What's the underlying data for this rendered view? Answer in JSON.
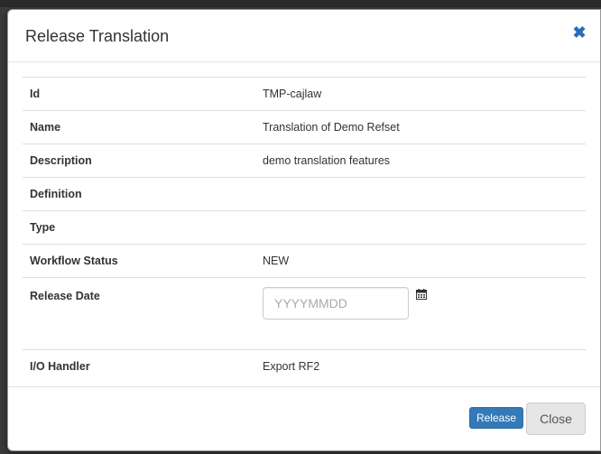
{
  "dialog": {
    "title": "Release Translation",
    "close_icon": "close-x-icon",
    "accent": "#2a6ebb"
  },
  "fields": [
    {
      "label": "Id",
      "value": "TMP-cajlaw"
    },
    {
      "label": "Name",
      "value": "Translation of Demo Refset"
    },
    {
      "label": "Description",
      "value": "demo translation features"
    },
    {
      "label": "Definition",
      "value": ""
    },
    {
      "label": "Type",
      "value": ""
    },
    {
      "label": "Workflow Status",
      "value": "NEW"
    },
    {
      "label": "Release Date",
      "value": "",
      "placeholder": "YYYYMMDD",
      "icon": "calendar-icon"
    },
    {
      "label": "I/O Handler",
      "value": "Export RF2"
    }
  ],
  "footer": {
    "release_label": "Release",
    "close_label": "Close",
    "primary_color": "#337ab7"
  }
}
